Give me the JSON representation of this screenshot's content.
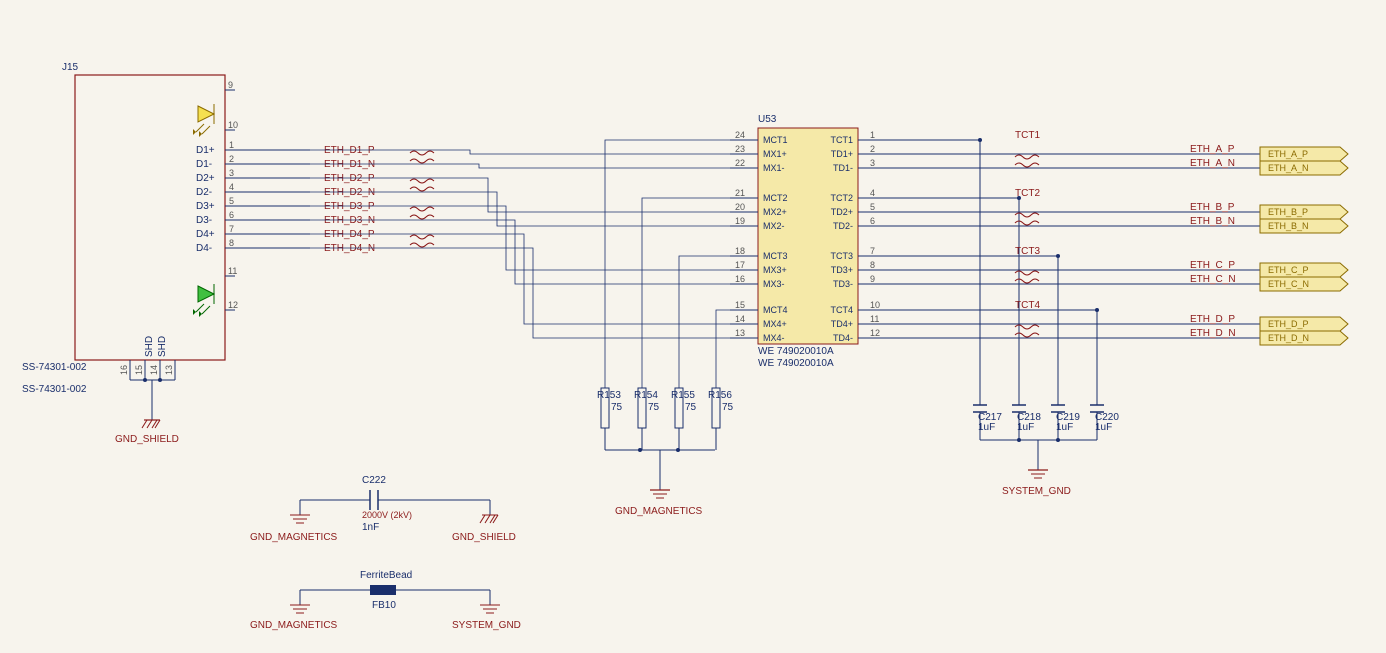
{
  "connector": {
    "refdes": "J15",
    "partnum1": "SS-74301-002",
    "partnum2": "SS-74301-002",
    "diff_pins": [
      {
        "num": "1",
        "name": "D1+",
        "net": "ETH_D1_P"
      },
      {
        "num": "2",
        "name": "D1-",
        "net": "ETH_D1_N"
      },
      {
        "num": "3",
        "name": "D2+",
        "net": "ETH_D2_P"
      },
      {
        "num": "4",
        "name": "D2-",
        "net": "ETH_D2_N"
      },
      {
        "num": "5",
        "name": "D3+",
        "net": "ETH_D3_P"
      },
      {
        "num": "6",
        "name": "D3-",
        "net": "ETH_D3_N"
      },
      {
        "num": "7",
        "name": "D4+",
        "net": "ETH_D4_P"
      },
      {
        "num": "8",
        "name": "D4-",
        "net": "ETH_D4_N"
      }
    ],
    "led1_pins": [
      "9",
      "10"
    ],
    "led2_pins": [
      "11",
      "12"
    ],
    "shield_pins": [
      "16",
      "15",
      "14",
      "13"
    ],
    "shield_label_a": "SHD",
    "shield_label_b": "SHD",
    "gnd": "GND_SHIELD"
  },
  "magnetics": {
    "refdes": "U53",
    "part": "WE 749020010A",
    "part2": "WE 749020010A",
    "left_pins": [
      {
        "num": "24",
        "name": "MCT1"
      },
      {
        "num": "23",
        "name": "MX1+"
      },
      {
        "num": "22",
        "name": "MX1-"
      },
      {
        "num": "21",
        "name": "MCT2"
      },
      {
        "num": "20",
        "name": "MX2+"
      },
      {
        "num": "19",
        "name": "MX2-"
      },
      {
        "num": "18",
        "name": "MCT3"
      },
      {
        "num": "17",
        "name": "MX3+"
      },
      {
        "num": "16",
        "name": "MX3-"
      },
      {
        "num": "15",
        "name": "MCT4"
      },
      {
        "num": "14",
        "name": "MX4+"
      },
      {
        "num": "13",
        "name": "MX4-"
      }
    ],
    "right_pins": [
      {
        "num": "1",
        "name": "TCT1"
      },
      {
        "num": "2",
        "name": "TD1+"
      },
      {
        "num": "3",
        "name": "TD1-"
      },
      {
        "num": "4",
        "name": "TCT2"
      },
      {
        "num": "5",
        "name": "TD2+"
      },
      {
        "num": "6",
        "name": "TD2-"
      },
      {
        "num": "7",
        "name": "TCT3"
      },
      {
        "num": "8",
        "name": "TD3+"
      },
      {
        "num": "9",
        "name": "TD3-"
      },
      {
        "num": "10",
        "name": "TCT4"
      },
      {
        "num": "11",
        "name": "TD4+"
      },
      {
        "num": "12",
        "name": "TD4-"
      }
    ],
    "tct_nets": [
      "TCT1",
      "TCT2",
      "TCT3",
      "TCT4"
    ]
  },
  "out_ports": [
    {
      "p": "ETH_A_P",
      "n": "ETH_A_N"
    },
    {
      "p": "ETH_B_P",
      "n": "ETH_B_N"
    },
    {
      "p": "ETH_C_P",
      "n": "ETH_C_N"
    },
    {
      "p": "ETH_D_P",
      "n": "ETH_D_N"
    }
  ],
  "term_resistors": [
    {
      "ref": "R153",
      "val": "75"
    },
    {
      "ref": "R154",
      "val": "75"
    },
    {
      "ref": "R155",
      "val": "75"
    },
    {
      "ref": "R156",
      "val": "75"
    }
  ],
  "term_gnd": "GND_MAGNETICS",
  "tct_caps": [
    {
      "ref": "C217",
      "val": "1uF"
    },
    {
      "ref": "C218",
      "val": "1uF"
    },
    {
      "ref": "C219",
      "val": "1uF"
    },
    {
      "ref": "C220",
      "val": "1uF"
    }
  ],
  "tct_gnd": "SYSTEM_GND",
  "hv_cap": {
    "ref": "C222",
    "voltage": "2000V (2kV)",
    "val": "1nF",
    "gnd_left": "GND_MAGNETICS",
    "gnd_right": "GND_SHIELD"
  },
  "ferrite": {
    "desc": "FerriteBead",
    "ref": "FB10",
    "gnd_left": "GND_MAGNETICS",
    "gnd_right": "SYSTEM_GND"
  }
}
